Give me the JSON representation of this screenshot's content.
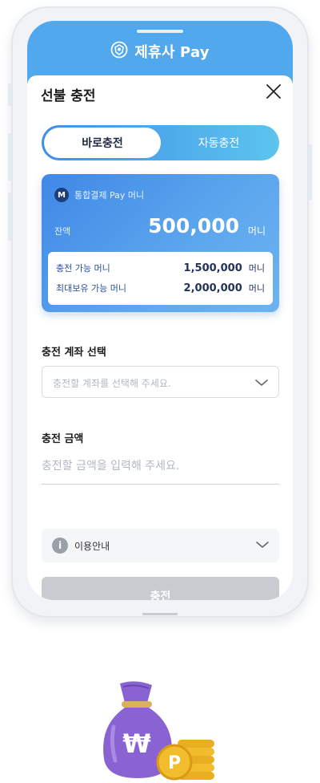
{
  "header": {
    "brand": "제휴사 Pay"
  },
  "sheet": {
    "title": "선불 충전"
  },
  "charge_mode": {
    "options": [
      "바로충전",
      "자동충전"
    ],
    "selected": "바로충전"
  },
  "card": {
    "title": "통합결제 Pay 머니",
    "badge": "M",
    "balance_label": "잔액",
    "balance_value": "500,000",
    "unit": "머니",
    "rows": [
      {
        "label": "충전 가능 머니",
        "value": "1,500,000",
        "unit": "머니"
      },
      {
        "label": "최대보유 가능 머니",
        "value": "2,000,000",
        "unit": "머니"
      }
    ]
  },
  "account": {
    "label": "충전 계좌 선택",
    "placeholder": "충전할 계좌를 선택해 주세요."
  },
  "amount": {
    "label": "충전 금액",
    "placeholder": "충전할 금액을 입력해 주세요."
  },
  "info": {
    "label": "이용안내",
    "icon": "i"
  },
  "submit": {
    "label": "충전"
  },
  "illustration": {
    "bag_symbol": "₩",
    "coin_symbol": "P"
  },
  "colors": {
    "brand_blue": "#52a8ec",
    "card_start": "#3f88e6",
    "card_end": "#6cb3f0",
    "disabled": "#c8cbd0",
    "bag_purple": "#8a63d2",
    "coin_gold": "#f2bd2c"
  }
}
